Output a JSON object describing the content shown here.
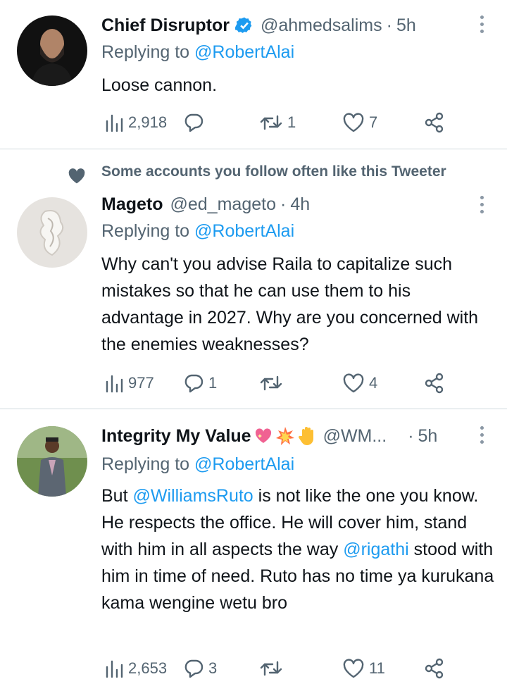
{
  "colors": {
    "text": "#0f1419",
    "secondary": "#536471",
    "link": "#1d9bf0",
    "divider": "#cfd9de",
    "verified": "#1d9bf0"
  },
  "tweets": [
    {
      "name": "Chief Disruptor",
      "verified": true,
      "handle": "@ahmedsalims",
      "dot": "·",
      "time": "5h",
      "replying_label": "Replying to ",
      "replying_to": "@RobertAlai",
      "text": "Loose cannon.",
      "views": "2,918",
      "replies": "",
      "retweets": "1",
      "likes": "7"
    },
    {
      "social_context": "Some accounts you follow often like this Tweeter",
      "name": "Mageto",
      "handle": "@ed_mageto",
      "dot": "·",
      "time": "4h",
      "replying_label": "Replying to ",
      "replying_to": "@RobertAlai",
      "text": "Why can't you advise Raila to capitalize such mistakes so that he can use them to his advantage in 2027. Why are you concerned with the enemies weaknesses?",
      "views": "977",
      "replies": "1",
      "retweets": "",
      "likes": "4"
    },
    {
      "name": "Integrity My Value",
      "name_emojis": [
        "sparkling-heart",
        "collision",
        "raised-hand"
      ],
      "handle": "@WM...",
      "dot": "·",
      "time": "5h",
      "replying_label": "Replying to ",
      "replying_to": "@RobertAlai",
      "text_parts": {
        "p1": "But ",
        "m1": "@WilliamsRuto",
        "p2": " is not like the one you know. He respects the office. He will cover him, stand with him in all aspects the way ",
        "m2": "@rigathi",
        "p3": " stood with him in time of need. Ruto has no time ya kurukana kama wengine wetu bro"
      },
      "views": "2,653",
      "replies": "3",
      "retweets": "",
      "likes": "11"
    }
  ],
  "icons": {
    "views": "views-icon",
    "reply": "reply-icon",
    "retweet": "retweet-icon",
    "like": "like-icon",
    "share": "share-icon",
    "more": "more-icon",
    "verified": "verified-badge-icon",
    "social_heart": "heart-icon"
  }
}
